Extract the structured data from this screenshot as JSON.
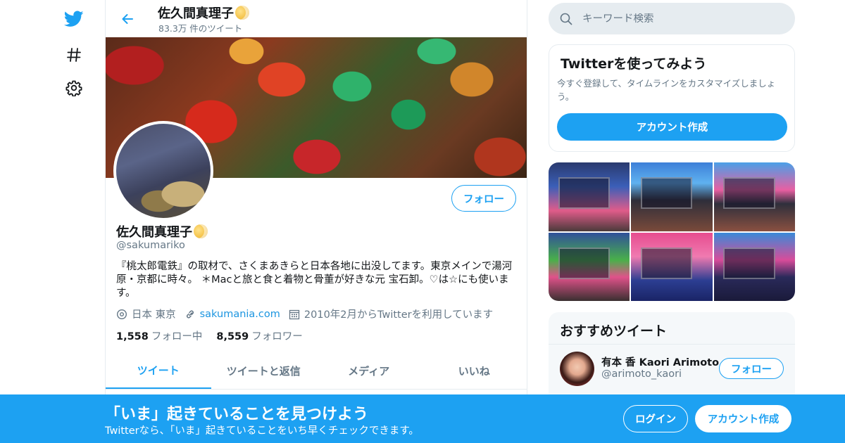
{
  "nav": {
    "logo_icon": "twitter-bird-icon",
    "explore_icon": "hashtag-icon",
    "settings_icon": "gear-icon"
  },
  "header": {
    "title": "佐久間真理子",
    "tweet_count": "83.3万 件のツイート"
  },
  "profile": {
    "name": "佐久間真理子",
    "handle": "@sakumariko",
    "follow_label": "フォロー",
    "bio": "『桃太郎電鉄』の取材で、さくまあきらと日本各地に出没してます。東京メインで湯河原・京都に時々。 ＊Macと旅と食と着物と骨董が好きな元 宝石卸。♡は☆にも使います。",
    "location": "日本 東京",
    "website": "sakumania.com",
    "joined": "2010年2月からTwitterを利用しています",
    "following_count": "1,558",
    "following_label": "フォロー中",
    "followers_count": "8,559",
    "followers_label": "フォロワー"
  },
  "tabs": [
    {
      "label": "ツイート",
      "active": true
    },
    {
      "label": "ツイートと返信",
      "active": false
    },
    {
      "label": "メディア",
      "active": false
    },
    {
      "label": "いいね",
      "active": false
    }
  ],
  "search": {
    "placeholder": "キーワード検索"
  },
  "signup_card": {
    "title": "Twitterを使ってみよう",
    "text": "今すぐ登録して、タイムラインをカスタマイズしましょう。",
    "button": "アカウント作成"
  },
  "recommend": {
    "title": "おすすめツイート",
    "user_name": "有本 香 Kaori Arimoto",
    "user_handle": "@arimoto_kaori",
    "follow_label": "フォロー"
  },
  "bottom_bar": {
    "title": "「いま」起きていることを見つけよう",
    "subtitle": "Twitterなら、「いま」起きていることをいち早くチェックできます。",
    "login": "ログイン",
    "signup": "アカウント作成"
  },
  "colors": {
    "accent": "#1da1f2",
    "text_primary": "#14171a",
    "text_secondary": "#657786",
    "border": "#e6ecf0"
  }
}
